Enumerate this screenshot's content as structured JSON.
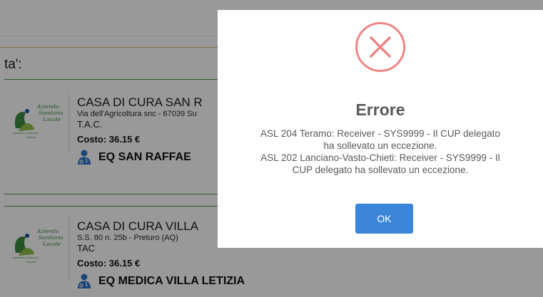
{
  "results_section": {
    "title": "ta':",
    "items": [
      {
        "name": "CASA DI CURA SAN R",
        "address": "Via dell'Agricoltura snc - 67039 Su",
        "exam": "T.A.C.",
        "cost": "Costo: 36.15 €",
        "provider": "EQ SAN RAFFAE",
        "logo": {
          "line1": "Azienda",
          "line2": "Sanitaria",
          "line3": "Locale",
          "line4": "Avezzano, Sulmona,",
          "line5": "L'Aquila"
        }
      },
      {
        "name": "CASA DI CURA VILLA",
        "address": "S.S. 80 n. 25b - Preturo (AQ)",
        "exam": "TAC",
        "cost": "Costo: 36.15 €",
        "provider": "EQ MEDICA VILLA LETIZIA",
        "logo": {
          "line1": "Azienda",
          "line2": "Sanitaria",
          "line3": "Locale",
          "line4": "Avezzano, Sulmona,",
          "line5": "L'Aquila"
        }
      }
    ]
  },
  "error_dialog": {
    "icon": "error-x-circle-icon",
    "title": "Errore",
    "message_lines": [
      "ASL 204 Teramo: Receiver - SYS9999 - Il CUP delegato",
      "ha sollevato un eccezione.",
      "ASL 202 Lanciano-Vasto-Chieti: Receiver - SYS9999 - Il",
      "CUP delegato ha sollevato un eccezione."
    ],
    "ok_label": "OK"
  },
  "colors": {
    "error_red": "#ef8585",
    "ok_button": "#3b86d9",
    "provider_icon": "#2f73c8",
    "divider_green": "#3f8f3f",
    "overlay": "rgba(0,0,0,0.40)"
  }
}
